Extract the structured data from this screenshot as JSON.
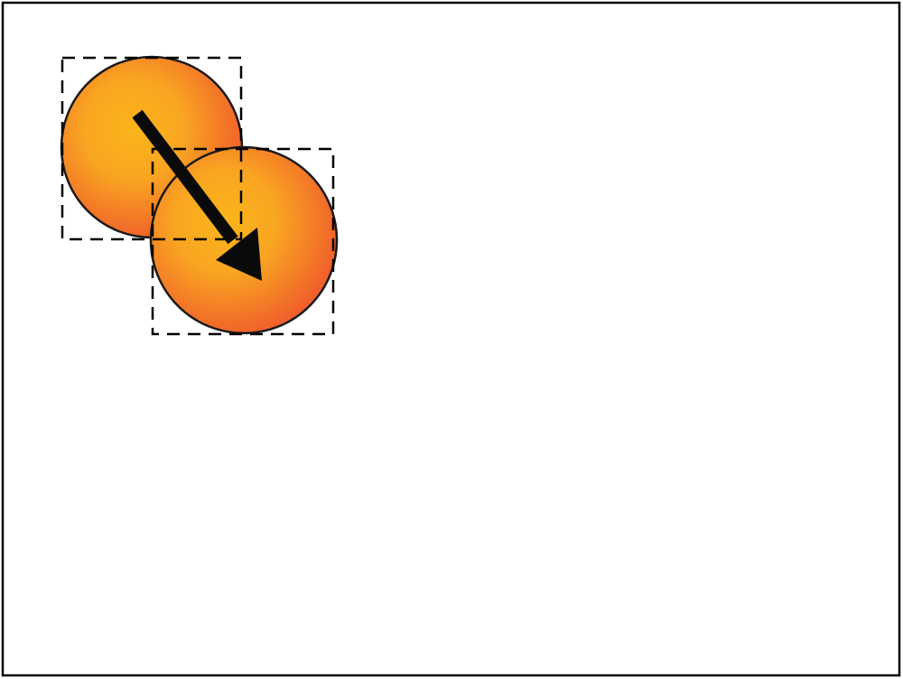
{
  "diagram": {
    "kind": "sprite-translation",
    "colors": {
      "background": "#ffffff",
      "frame": "#000000",
      "ball_center": "#fbb51a",
      "ball_edge": "#f0602a",
      "ball_outline": "#1a1a1a",
      "bounding_box": "#000000",
      "arrow": "#0a0a0a"
    },
    "objects": [
      {
        "id": "ball-start",
        "shape": "circle",
        "fill": "radial-gradient",
        "bounding_box": "dashed"
      },
      {
        "id": "ball-end",
        "shape": "circle",
        "fill": "radial-gradient",
        "bounding_box": "dashed"
      }
    ],
    "motion": {
      "from": "ball-start",
      "to": "ball-end",
      "direction": "down-right"
    }
  }
}
